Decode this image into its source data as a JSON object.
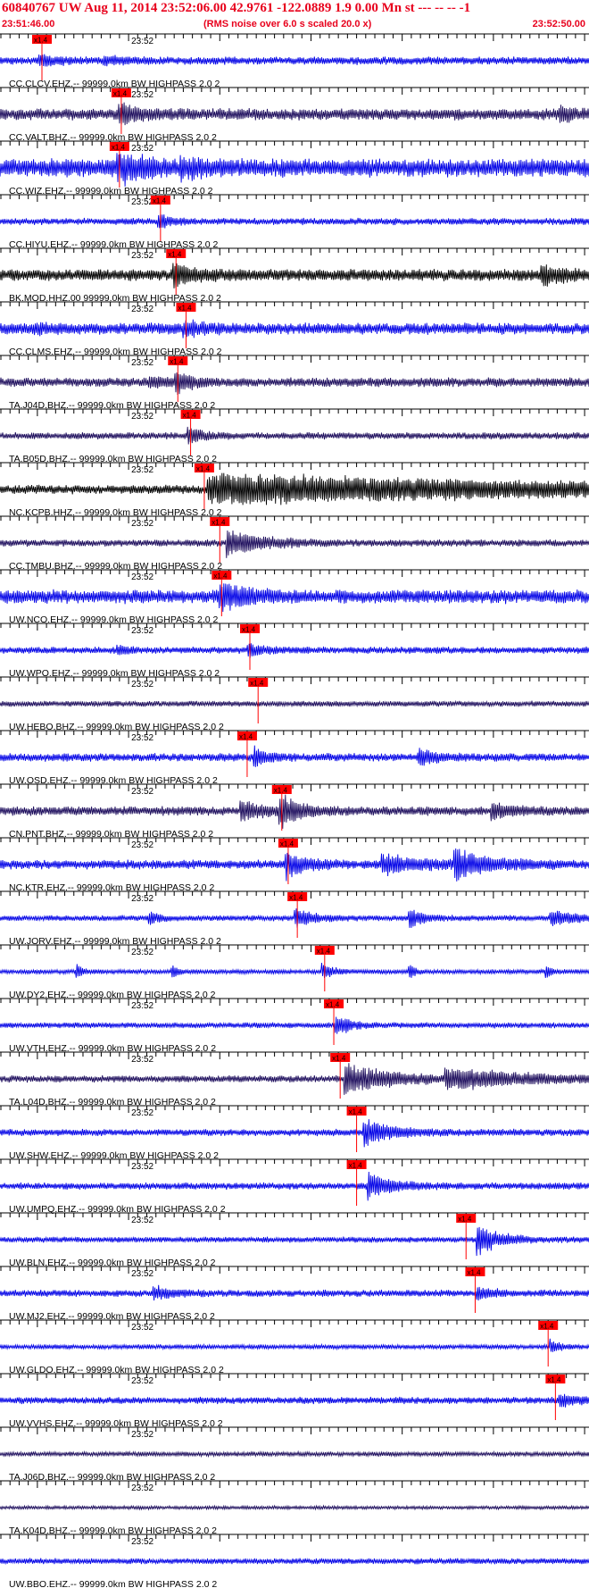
{
  "header": {
    "title": "60840767 UW Aug 11, 2014 23:52:06.00   42.9761 -122.0889  1.9 0.00 Mn st --- -- --   -1",
    "subtitle": "(RMS noise over 6.0 s scaled 20.0 x)",
    "start_time": "23:51:46.00",
    "end_time": "23:52:50.00",
    "minute_label": "23:52",
    "pick_label": "x1.4"
  },
  "chart_data": {
    "type": "line",
    "title": "60840767 UW Aug 11, 2014 23:52:06.00   42.9761 -122.0889  1.9 0.00 Mn st --- -- --   -1",
    "x_axis": {
      "start": "23:51:46.00",
      "end": "23:52:50.00",
      "range_seconds": [
        0,
        64
      ],
      "minute_mark": "23:52",
      "minute_mark_seconds": 14
    },
    "colors": {
      "blue": "#0000e6",
      "navy": "#1c0c5c",
      "black": "#000000",
      "pick": "#ff0000",
      "header": "#e8001c"
    },
    "series": [
      {
        "name": "CC.CLCV.EHZ.-- 99999.0km BW  HIGHPASS  2.0  2",
        "pick_s": 4.5,
        "amp": 0.7,
        "color": "blue",
        "events": [
          [
            4.5,
            0.9,
            1.5
          ],
          [
            11.5,
            0.6,
            1.5
          ]
        ]
      },
      {
        "name": "CC.VALT.BHZ.-- 99999.0km BW  HIGHPASS  2.0  2",
        "pick_s": 13.2,
        "amp": 1.0,
        "color": "navy",
        "events": [
          [
            13.2,
            1.6,
            2.0
          ],
          [
            61.5,
            1.0,
            1.5
          ]
        ]
      },
      {
        "name": "CC.WIZ.EHZ.-- 99999.0km BW  HIGHPASS  2.0  2",
        "pick_s": 13.0,
        "amp": 1.6,
        "color": "blue",
        "events": [
          [
            13.0,
            2.0,
            3.0
          ],
          [
            20.0,
            0.8,
            2.0
          ]
        ]
      },
      {
        "name": "CC.HIYU.EHZ.-- 99999.0km BW  HIGHPASS  2.0  2",
        "pick_s": 17.5,
        "amp": 0.6,
        "color": "blue",
        "events": [
          [
            17.5,
            1.0,
            1.5
          ]
        ]
      },
      {
        "name": "BK.MOD.HHZ.00 99999.0km BW  HIGHPASS  2.0  2",
        "pick_s": 19.2,
        "amp": 1.0,
        "color": "black",
        "events": [
          [
            19.2,
            1.6,
            2.5
          ],
          [
            59.5,
            1.3,
            2.5
          ]
        ]
      },
      {
        "name": "CC.CLMS.EHZ.-- 99999.0km BW  HIGHPASS  2.0  2",
        "pick_s": 20.3,
        "amp": 1.0,
        "color": "blue",
        "events": [
          [
            20.3,
            1.0,
            2.0
          ],
          [
            4.0,
            0.5,
            1.5
          ]
        ]
      },
      {
        "name": "TA.J04D.BHZ.-- 99999.0km BW  HIGHPASS  2.0  2",
        "pick_s": 19.4,
        "amp": 0.8,
        "color": "navy",
        "events": [
          [
            19.4,
            1.7,
            1.5
          ],
          [
            16.5,
            0.8,
            1.5
          ]
        ]
      },
      {
        "name": "TA.B05D.BHZ.-- 99999.0km BW  HIGHPASS  2.0  2",
        "pick_s": 20.8,
        "amp": 0.6,
        "color": "navy",
        "events": [
          [
            20.8,
            1.2,
            1.5
          ]
        ]
      },
      {
        "name": "NC.KCPB.HHZ.-- 99999.0km BW  HIGHPASS  2.0  2",
        "pick_s": 22.3,
        "amp": 0.8,
        "color": "black",
        "events": [
          [
            23.0,
            2.4,
            40.0
          ]
        ]
      },
      {
        "name": "CC.TMBU.BHZ.-- 99999.0km BW  HIGHPASS  2.0  2",
        "pick_s": 24.0,
        "amp": 0.6,
        "color": "navy",
        "events": [
          [
            25.0,
            2.0,
            4.0
          ]
        ]
      },
      {
        "name": "UW.NCO.EHZ.-- 99999.0km BW  HIGHPASS  2.0  2",
        "pick_s": 24.2,
        "amp": 1.2,
        "color": "blue",
        "events": [
          [
            24.2,
            2.0,
            3.0
          ]
        ]
      },
      {
        "name": "UW.WPO.EHZ.-- 99999.0km BW  HIGHPASS  2.0  2",
        "pick_s": 27.3,
        "amp": 0.6,
        "color": "blue",
        "events": [
          [
            27.3,
            1.0,
            1.5
          ],
          [
            13.0,
            0.7,
            1.0
          ]
        ]
      },
      {
        "name": "UW.HEBO.BHZ.-- 99999.0km BW  HIGHPASS  2.0  2",
        "pick_s": 28.2,
        "amp": 0.5,
        "color": "navy",
        "events": []
      },
      {
        "name": "UW.OSD.EHZ.-- 99999.0km BW  HIGHPASS  2.0  2",
        "pick_s": 27.0,
        "amp": 0.7,
        "color": "blue",
        "events": [
          [
            28.0,
            1.5,
            1.5
          ],
          [
            46.0,
            1.3,
            2.0
          ]
        ]
      },
      {
        "name": "CN.PNT.BHZ.-- 99999.0km BW  HIGHPASS  2.0  2",
        "pick_s": 30.8,
        "amp": 0.8,
        "color": "navy",
        "events": [
          [
            30.8,
            2.4,
            2.0
          ],
          [
            26.5,
            1.5,
            2.5
          ],
          [
            54.0,
            1.2,
            2.0
          ]
        ]
      },
      {
        "name": "NC.KTR.EHZ.-- 99999.0km BW  HIGHPASS  2.0  2",
        "pick_s": 31.5,
        "amp": 0.8,
        "color": "blue",
        "events": [
          [
            31.5,
            2.0,
            2.0
          ],
          [
            42.0,
            1.5,
            4.0
          ],
          [
            50.0,
            2.4,
            3.5
          ]
        ]
      },
      {
        "name": "UW.JORV.EHZ.-- 99999.0km BW  HIGHPASS  2.0  2",
        "pick_s": 32.5,
        "amp": 0.5,
        "color": "blue",
        "events": [
          [
            32.5,
            1.5,
            2.0
          ],
          [
            16.5,
            1.0,
            1.0
          ],
          [
            45.0,
            1.5,
            1.5
          ],
          [
            60.5,
            1.3,
            2.5
          ]
        ]
      },
      {
        "name": "UW.DY2.EHZ.-- 99999.0km BW  HIGHPASS  2.0  2",
        "pick_s": 35.5,
        "amp": 0.4,
        "color": "blue",
        "events": [
          [
            35.5,
            1.3,
            1.0
          ],
          [
            8.5,
            1.3,
            0.5
          ],
          [
            19.0,
            1.0,
            0.5
          ],
          [
            45.0,
            1.2,
            0.5
          ],
          [
            60.0,
            1.1,
            0.5
          ]
        ]
      },
      {
        "name": "UW.VTH.EHZ.-- 99999.0km BW  HIGHPASS  2.0  2",
        "pick_s": 36.5,
        "amp": 0.5,
        "color": "blue",
        "events": [
          [
            37.0,
            1.7,
            1.5
          ]
        ]
      },
      {
        "name": "TA.L04D.BHZ.-- 99999.0km BW  HIGHPASS  2.0  2",
        "pick_s": 37.2,
        "amp": 0.6,
        "color": "navy",
        "events": [
          [
            38.0,
            2.4,
            5.0
          ],
          [
            49.0,
            1.5,
            10.0
          ]
        ]
      },
      {
        "name": "UW.SHW.EHZ.-- 99999.0km BW  HIGHPASS  2.0  2",
        "pick_s": 39.0,
        "amp": 0.6,
        "color": "blue",
        "events": [
          [
            40.0,
            2.2,
            3.0
          ]
        ]
      },
      {
        "name": "UW.UMPQ.EHZ.-- 99999.0km BW  HIGHPASS  2.0  2",
        "pick_s": 39.0,
        "amp": 0.6,
        "color": "blue",
        "events": [
          [
            40.5,
            2.0,
            2.5
          ]
        ]
      },
      {
        "name": "UW.BLN.EHZ.-- 99999.0km BW  HIGHPASS  2.0  2",
        "pick_s": 51.0,
        "amp": 0.5,
        "color": "blue",
        "events": [
          [
            52.5,
            2.4,
            2.5
          ]
        ]
      },
      {
        "name": "UW.MJ2.EHZ.-- 99999.0km BW  HIGHPASS  2.0  2",
        "pick_s": 52.0,
        "amp": 0.6,
        "color": "blue",
        "events": [
          [
            17.0,
            0.9,
            2.0
          ],
          [
            52.5,
            1.0,
            1.5
          ]
        ]
      },
      {
        "name": "UW.GLDO.EHZ.-- 99999.0km BW  HIGHPASS  2.0  2",
        "pick_s": 60.0,
        "amp": 0.4,
        "color": "blue",
        "events": [
          [
            60.5,
            1.0,
            1.0
          ]
        ]
      },
      {
        "name": "UW.VVHS.EHZ.-- 99999.0km BW  HIGHPASS  2.0  2",
        "pick_s": 60.8,
        "amp": 0.6,
        "color": "blue",
        "events": [
          [
            61.5,
            1.2,
            1.5
          ]
        ]
      },
      {
        "name": "TA.J06D.BHZ.-- 99999.0km BW  HIGHPASS  2.0  2",
        "pick_s": null,
        "amp": 0.4,
        "color": "navy",
        "events": []
      },
      {
        "name": "TA.K04D.BHZ.-- 99999.0km BW  HIGHPASS  2.0  2",
        "pick_s": null,
        "amp": 0.3,
        "color": "navy",
        "events": []
      },
      {
        "name": "UW.BBO.EHZ.-- 99999.0km BW  HIGHPASS  2.0  2",
        "pick_s": null,
        "amp": 0.5,
        "color": "blue",
        "events": []
      }
    ]
  }
}
